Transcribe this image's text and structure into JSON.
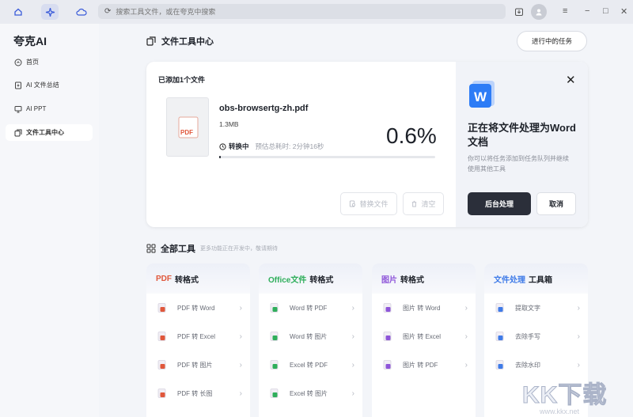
{
  "topbar": {
    "search_placeholder": "搜索工具文件，或在夸克中搜索"
  },
  "sidebar": {
    "app_name": "夸克AI",
    "items": [
      {
        "label": "首页"
      },
      {
        "label": "AI 文件总结"
      },
      {
        "label": "AI PPT"
      },
      {
        "label": "文件工具中心"
      }
    ]
  },
  "header": {
    "title": "文件工具中心",
    "tasks_button": "进行中的任务"
  },
  "conversion": {
    "added_label": "已添加1个文件",
    "thumb_badge": "PDF",
    "file_name": "obs-browsertg-zh.pdf",
    "file_size": "1.3MB",
    "status": "转换中",
    "eta": "预估总耗时: 2分钟16秒",
    "percent": "0.6%",
    "progress": 0.006,
    "replace_button": "替换文件",
    "clear_button": "清空"
  },
  "process_panel": {
    "title": "正在将文件处理为Word文档",
    "description": "你可以将任务添加到任务队列并继续使用其他工具",
    "background_button": "后台处理",
    "cancel_button": "取消"
  },
  "tools": {
    "title": "全部工具",
    "subtitle": "更多功能正在开发中，敬请期待",
    "columns": [
      {
        "highlight": "PDF",
        "rest": " 转格式",
        "color": "#e0573b",
        "items": [
          "PDF 转 Word",
          "PDF 转 Excel",
          "PDF 转 图片",
          "PDF 转 长图"
        ]
      },
      {
        "highlight": "Office文件",
        "rest": " 转格式",
        "color": "#2fae5b",
        "items": [
          "Word 转 PDF",
          "Word 转 图片",
          "Excel 转 PDF",
          "Excel 转 图片"
        ]
      },
      {
        "highlight": "图片",
        "rest": " 转格式",
        "color": "#8e55d9",
        "items": [
          "图片 转 Word",
          "图片 转 Excel",
          "图片 转 PDF"
        ]
      },
      {
        "highlight": "文件处理",
        "rest": " 工具箱",
        "color": "#3f7be8",
        "items": [
          "提取文字",
          "去除手写",
          "去除水印"
        ]
      }
    ]
  },
  "watermark": {
    "text": "KK下载",
    "url": "www.kkx.net"
  }
}
